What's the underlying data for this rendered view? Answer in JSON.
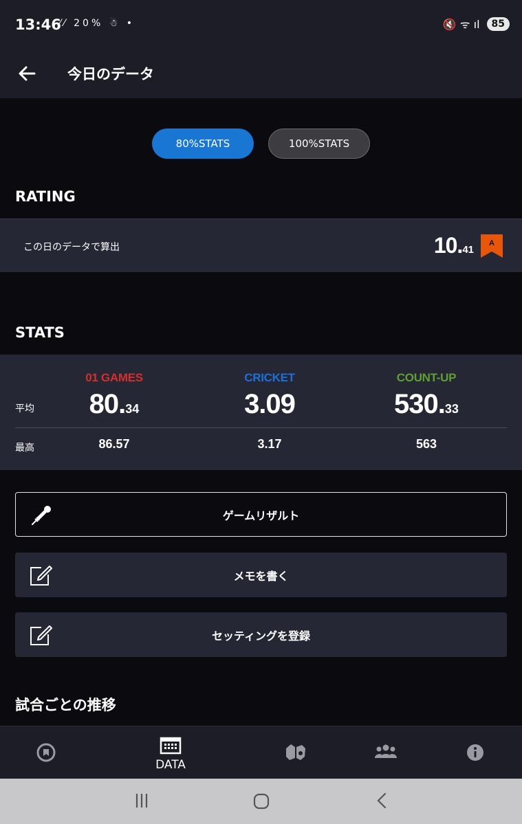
{
  "status_bar": {
    "time": "13:46",
    "left_icons": "⁄⁄ 20% ☃ •",
    "right_icons": "🔇 ᯤ ıl",
    "battery": "85"
  },
  "app_bar": {
    "title": "今日のデータ",
    "back_icon": "arrow-left-icon"
  },
  "stats_toggle": {
    "options": [
      "80%STATS",
      "100%STATS"
    ],
    "selected": "80%STATS",
    "accent": "#1976d2"
  },
  "rating": {
    "section_title": "RATING",
    "label": "この日のデータで算出",
    "value_int": "10.",
    "value_dec": "41",
    "badge_letter": "A",
    "badge_color": "#e8560c"
  },
  "stats": {
    "section_title": "STATS",
    "avg_label": "平均",
    "max_label": "最高",
    "columns": [
      {
        "name": "01 GAMES",
        "color": "#d32f2f",
        "avg_int": "80.",
        "avg_dec": "34",
        "max": "86.57"
      },
      {
        "name": "CRICKET",
        "color": "#1e6fd9",
        "avg_int": "3.09",
        "avg_dec": "",
        "max": "3.17"
      },
      {
        "name": "COUNT-UP",
        "color": "#5ea032",
        "avg_int": "530.",
        "avg_dec": "33",
        "max": "563"
      }
    ]
  },
  "actions": [
    {
      "label": "ゲームリザルト",
      "icon": "dart-icon"
    },
    {
      "label": "メモを書く",
      "icon": "edit-icon"
    },
    {
      "label": "セッティングを登録",
      "icon": "edit-icon"
    }
  ],
  "trend_title": "試合ごとの推移",
  "bottom_nav": {
    "items": [
      {
        "icon": "home-badge-icon",
        "label": ""
      },
      {
        "icon": "calendar-icon",
        "label": "DATA",
        "active": true
      },
      {
        "icon": "puzzle-icon",
        "label": ""
      },
      {
        "icon": "people-icon",
        "label": ""
      },
      {
        "icon": "info-icon",
        "label": ""
      }
    ]
  }
}
